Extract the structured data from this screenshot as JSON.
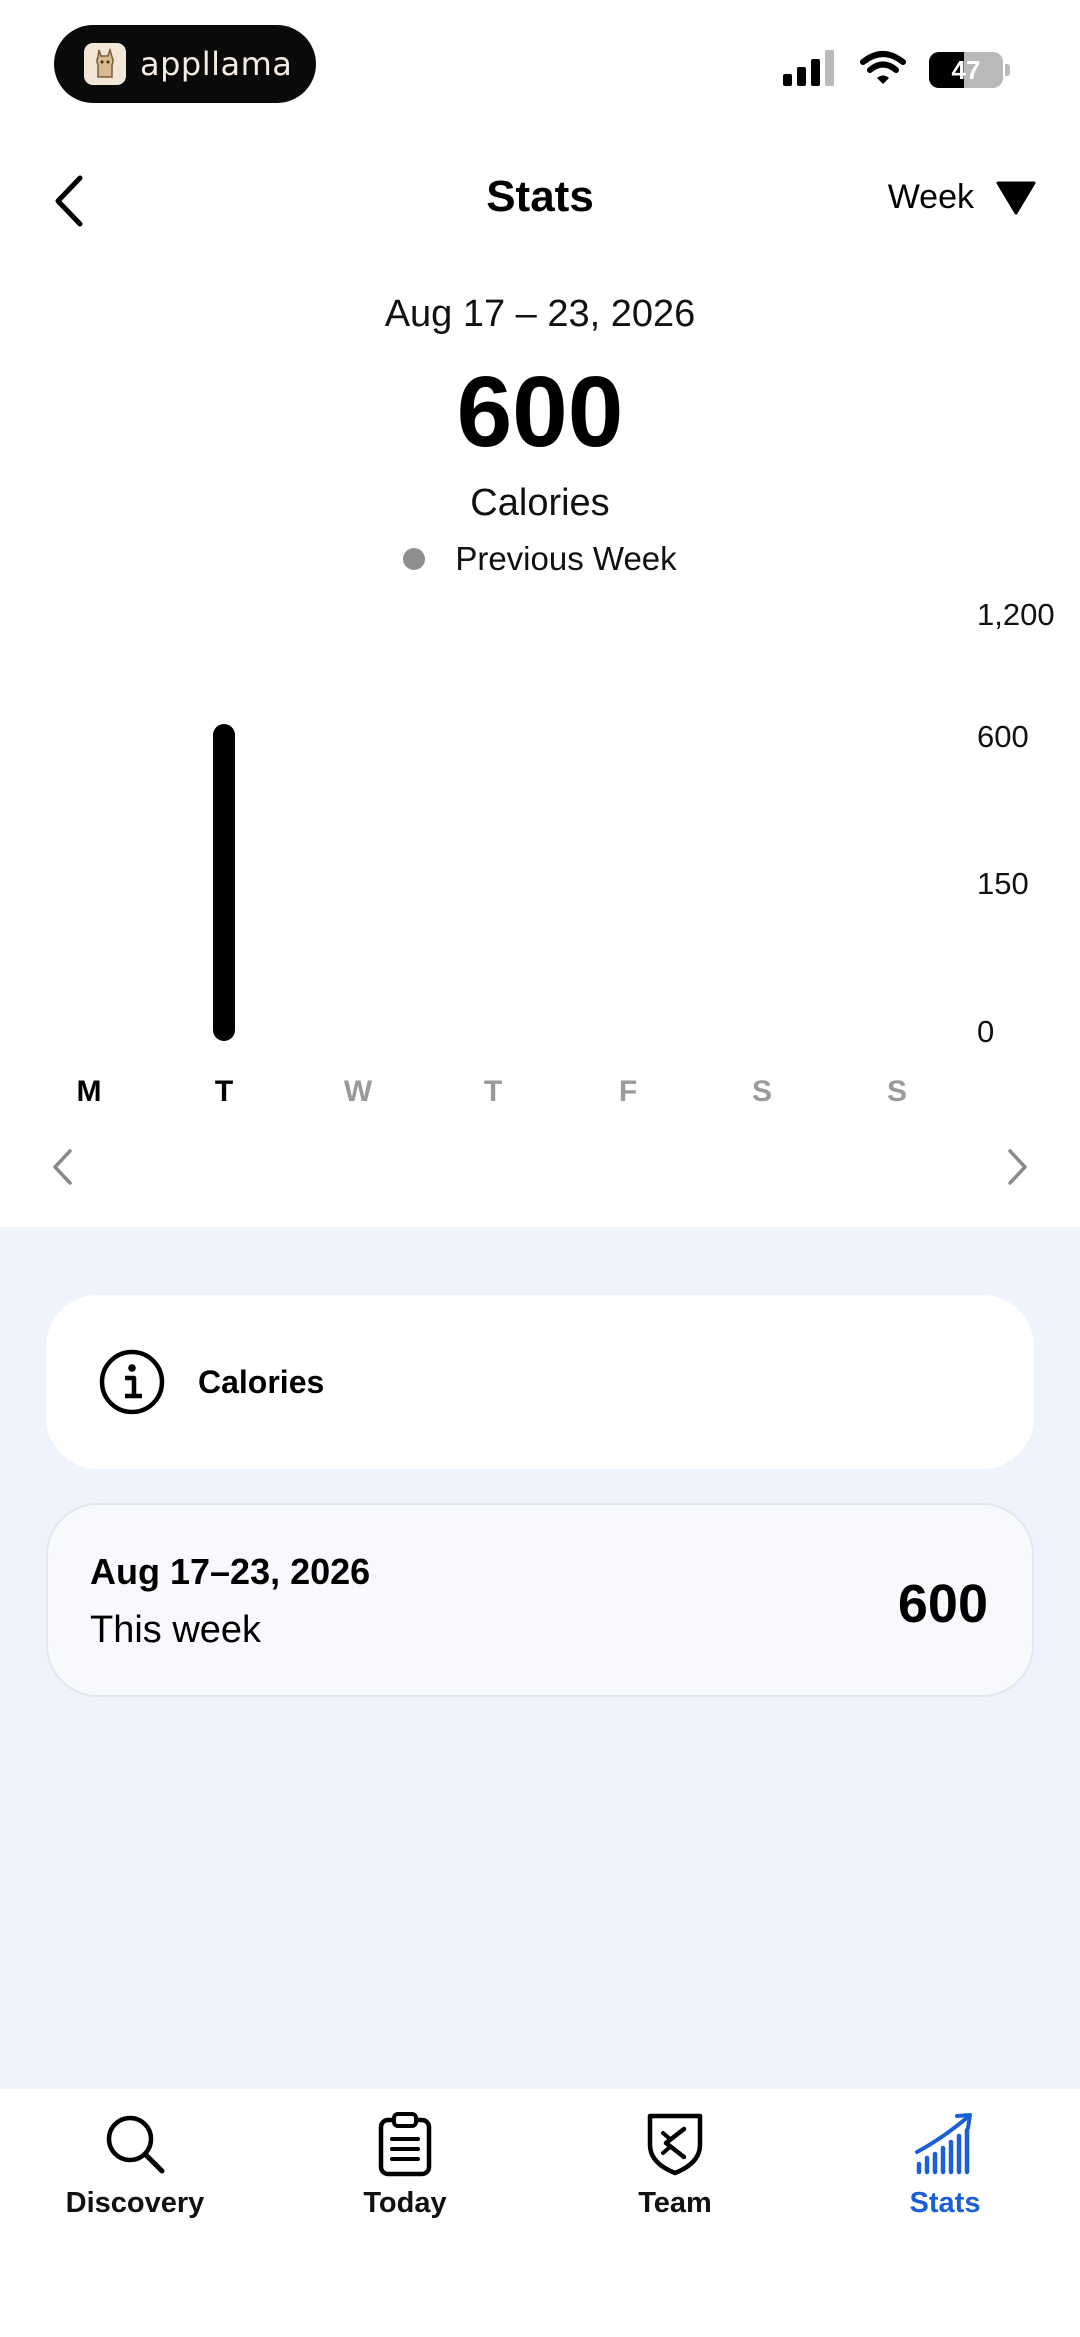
{
  "status_bar": {
    "app_pill_label": "appllama",
    "battery_level": "47"
  },
  "header": {
    "title": "Stats",
    "range_label": "Week"
  },
  "summary": {
    "date_range": "Aug 17 – 23, 2026",
    "total": "600",
    "metric": "Calories",
    "legend_label": "Previous Week"
  },
  "chart_data": {
    "type": "bar",
    "categories": [
      "M",
      "T",
      "W",
      "T",
      "F",
      "S",
      "S"
    ],
    "values": [
      0,
      600,
      0,
      0,
      0,
      0,
      0
    ],
    "y_ticks": [
      "1,200",
      "600",
      "150",
      "0"
    ],
    "ylim": [
      0,
      1200
    ],
    "active_days": [
      0,
      1
    ],
    "bar_color": "#000000",
    "grid": false
  },
  "info_card": {
    "label": "Calories"
  },
  "week_card": {
    "date": "Aug 17–23, 2026",
    "subtitle": "This week",
    "value": "600"
  },
  "tabs": [
    {
      "label": "Discovery",
      "icon": "search-icon"
    },
    {
      "label": "Today",
      "icon": "clipboard-icon"
    },
    {
      "label": "Team",
      "icon": "shield-icon"
    },
    {
      "label": "Stats",
      "icon": "stats-icon",
      "active": true
    }
  ],
  "colors": {
    "accent": "#1a5fd8",
    "lower_background": "#eff3fc",
    "inactive_day": "#9a9a9a",
    "legend_dot": "#8e8e8e"
  }
}
